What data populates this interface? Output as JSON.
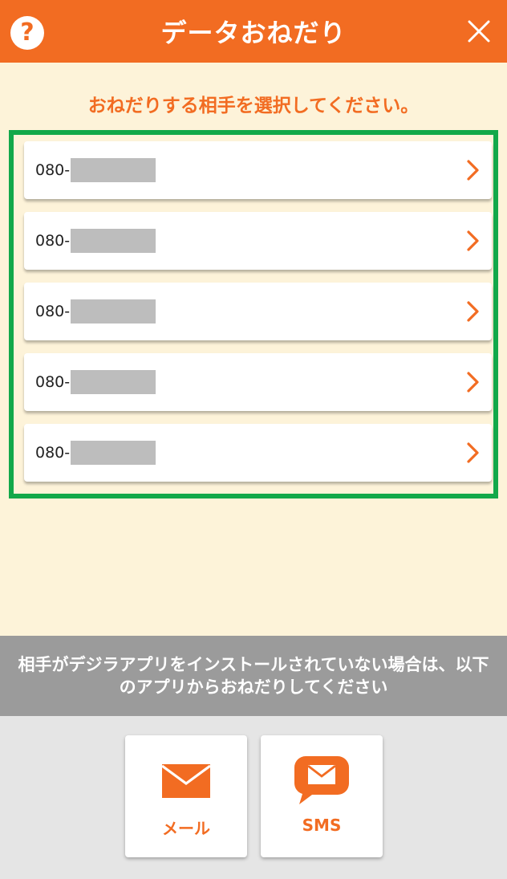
{
  "header": {
    "title": "データおねだり",
    "help_label": "?",
    "help_icon": "question-circle-icon",
    "close_icon": "close-x-icon"
  },
  "prompt": "おねだりする相手を選択してください。",
  "contacts": [
    {
      "prefix": "080-"
    },
    {
      "prefix": "080-"
    },
    {
      "prefix": "080-"
    },
    {
      "prefix": "080-"
    },
    {
      "prefix": "080-"
    }
  ],
  "notice": {
    "line1": "相手がデジラアプリをインストールされていない場合は、以下",
    "line2": "のアプリからおねだりしてください"
  },
  "apps": {
    "mail": {
      "label": "メール",
      "icon": "envelope-icon"
    },
    "sms": {
      "label": "SMS",
      "icon": "chat-bubble-envelope-icon"
    }
  },
  "colors": {
    "accent": "#f26c22",
    "highlight_frame": "#12a84a",
    "background": "#fdf3d9",
    "notice_bg": "#9b9b9b",
    "bottom_bg": "#e5e5e5"
  }
}
